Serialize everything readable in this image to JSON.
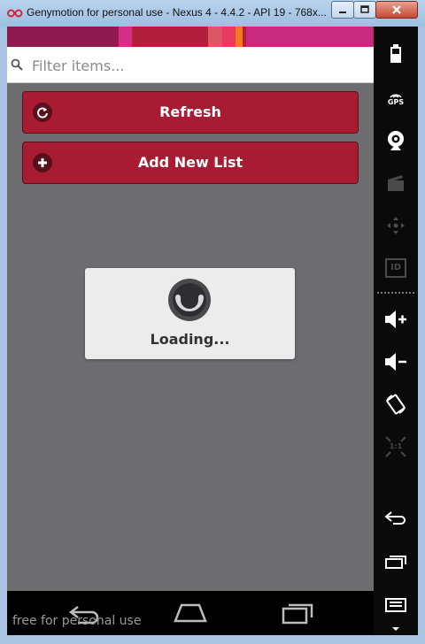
{
  "window": {
    "title": "Genymotion for personal use - Nexus 4 - 4.4.2 - API 19 - 768x..."
  },
  "filter": {
    "placeholder": "Filter items..."
  },
  "actions": {
    "refresh_label": "Refresh",
    "add_list_label": "Add New List"
  },
  "loading": {
    "text": "Loading..."
  },
  "watermark": {
    "text": "free for personal use"
  },
  "toolbar": {
    "gps_label": "GPS",
    "id_label": "ID",
    "scale_label": "1:1"
  },
  "colors": {
    "accent_red": "#a71c32",
    "screen_gray": "#6d6d70",
    "stripe": [
      "#8f1a52",
      "#d42e85",
      "#b11f3c",
      "#e05563",
      "#e83a5e",
      "#f07a1c",
      "#c82a7d"
    ]
  }
}
